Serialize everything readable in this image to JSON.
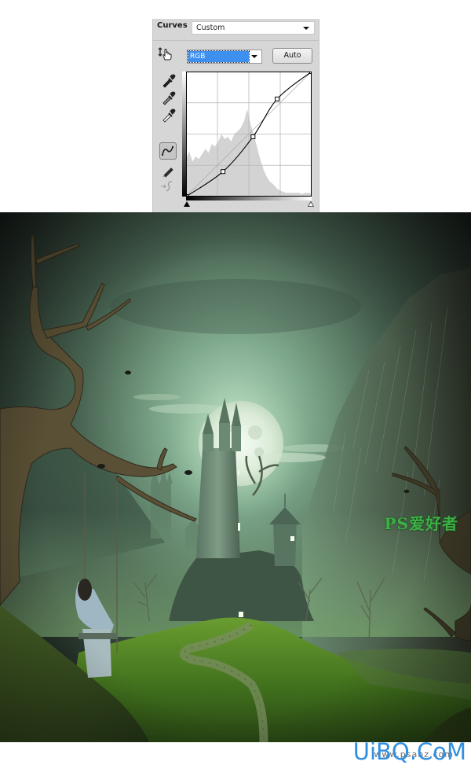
{
  "curves_panel": {
    "title": "Curves",
    "preset": "Custom",
    "channel": "RGB",
    "auto_label": "Auto",
    "tools": [
      {
        "name": "on-image-adjust-tool",
        "icon": "hand-arrows-icon"
      },
      {
        "name": "black-point-eyedropper",
        "icon": "eyedropper-black-icon"
      },
      {
        "name": "gray-point-eyedropper",
        "icon": "eyedropper-gray-icon"
      },
      {
        "name": "white-point-eyedropper",
        "icon": "eyedropper-white-icon"
      },
      {
        "name": "edit-points-curve-tool",
        "icon": "curve-icon",
        "active": true
      },
      {
        "name": "draw-pencil-tool",
        "icon": "pencil-icon"
      },
      {
        "name": "smooth-curve-tool",
        "icon": "smooth-icon",
        "disabled": true
      }
    ],
    "curve_points": [
      [
        0,
        0
      ],
      [
        75,
        51
      ],
      [
        136,
        122
      ],
      [
        185,
        199
      ],
      [
        255,
        255
      ]
    ],
    "grid_divisions": 4,
    "colors": {
      "panel_bg": "#d6d6d6",
      "selection": "#3d8ff0",
      "histogram": "#d3d3d3",
      "grid": "#b8b8b8",
      "curve": "#000000"
    }
  },
  "artwork": {
    "description": "Dark fantasy scene: full moon behind castle tower, twisted trees with crows, girl on swing, grassy hill with stone path",
    "palette": {
      "sky_dark": "#1a211d",
      "sky_glow": "#7fa88e",
      "moon": "#e6f2e6",
      "tower": "#6f8a78",
      "grass": "#3f6a1f",
      "grass_light": "#64962e",
      "tree": "#4e4630"
    }
  },
  "watermark": {
    "site_cn": "PS爱好者",
    "logo": "UiBQ.CoM",
    "url": "www.psahz.com"
  }
}
